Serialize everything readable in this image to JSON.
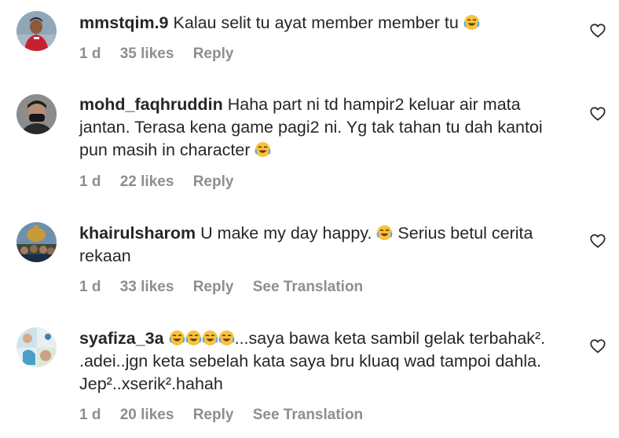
{
  "comments": [
    {
      "username": "mmstqim.9",
      "text_before": "Kalau selit tu ayat member member tu ",
      "text_after": "",
      "emoji_count": 1,
      "emoji": "face-with-tears-of-joy-icon",
      "time": "1 d",
      "likes": "35 likes",
      "reply": "Reply",
      "translation": ""
    },
    {
      "username": "mohd_faqhruddin",
      "text_before": "Haha part ni td hampir2 keluar air mata jantan. Terasa kena game pagi2 ni. Yg tak tahan tu dah kantoi pun masih in character ",
      "text_after": "",
      "emoji_count": 1,
      "emoji": "face-with-tears-of-joy-icon",
      "time": "1 d",
      "likes": "22 likes",
      "reply": "Reply",
      "translation": ""
    },
    {
      "username": "khairulsharom",
      "text_before": "U make my day happy. ",
      "text_after": " Serius betul cerita rekaan",
      "emoji_count": 1,
      "emoji": "face-with-tears-of-joy-icon",
      "time": "1 d",
      "likes": "33 likes",
      "reply": "Reply",
      "translation": "See Translation"
    },
    {
      "username": "syafiza_3a",
      "text_before": "",
      "text_after": "...saya bawa keta sambil gelak terbahak².​.adei..jgn keta sebelah kata saya bru kluaq wad tampoi dahla. Jep²..xserik².hahah",
      "emoji_count": 4,
      "emoji": "face-with-tears-of-joy-icon",
      "time": "1 d",
      "likes": "20 likes",
      "reply": "Reply",
      "translation": "See Translation"
    }
  ],
  "colors": {
    "text": "#262626",
    "secondary": "#8e8e8e",
    "background": "#ffffff",
    "emoji_face": "#f9c23c"
  },
  "icons": {
    "like": "heart-outline-icon",
    "emoji": "face-with-tears-of-joy-icon"
  }
}
